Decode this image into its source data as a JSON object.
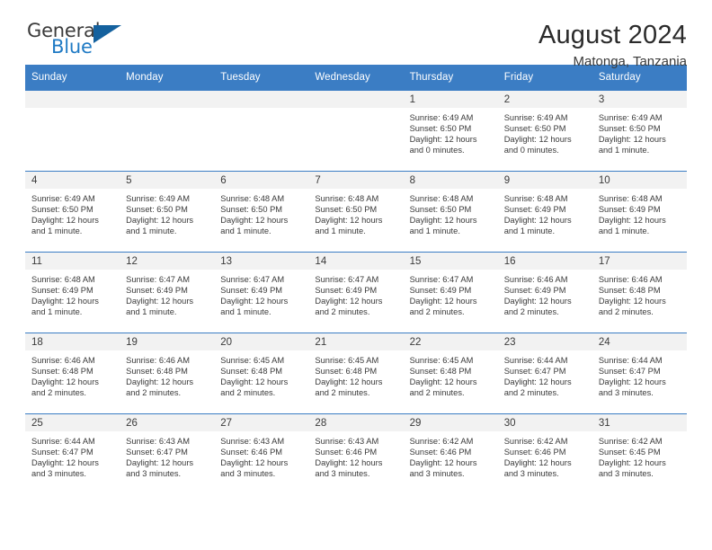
{
  "brand": {
    "name_part1": "General",
    "name_part2": "Blue",
    "triangle_icon": "triangle-icon",
    "color_dark": "#3b3b3b",
    "color_blue": "#1f7ac4",
    "triangle_color": "#14619e"
  },
  "header": {
    "title": "August 2024",
    "subtitle": "Matonga, Tanzania"
  },
  "accent_color": "#3b7dc4",
  "daynum_bg": "#f2f2f2",
  "weekdays": [
    "Sunday",
    "Monday",
    "Tuesday",
    "Wednesday",
    "Thursday",
    "Friday",
    "Saturday"
  ],
  "labels": {
    "sunrise": "Sunrise:",
    "sunset": "Sunset:",
    "daylight": "Daylight:"
  },
  "weeks": [
    [
      {
        "day": "",
        "empty": true
      },
      {
        "day": "",
        "empty": true
      },
      {
        "day": "",
        "empty": true
      },
      {
        "day": "",
        "empty": true
      },
      {
        "day": "1",
        "sunrise": "Sunrise: 6:49 AM",
        "sunset": "Sunset: 6:50 PM",
        "daylight1": "Daylight: 12 hours",
        "daylight2": "and 0 minutes."
      },
      {
        "day": "2",
        "sunrise": "Sunrise: 6:49 AM",
        "sunset": "Sunset: 6:50 PM",
        "daylight1": "Daylight: 12 hours",
        "daylight2": "and 0 minutes."
      },
      {
        "day": "3",
        "sunrise": "Sunrise: 6:49 AM",
        "sunset": "Sunset: 6:50 PM",
        "daylight1": "Daylight: 12 hours",
        "daylight2": "and 1 minute."
      }
    ],
    [
      {
        "day": "4",
        "sunrise": "Sunrise: 6:49 AM",
        "sunset": "Sunset: 6:50 PM",
        "daylight1": "Daylight: 12 hours",
        "daylight2": "and 1 minute."
      },
      {
        "day": "5",
        "sunrise": "Sunrise: 6:49 AM",
        "sunset": "Sunset: 6:50 PM",
        "daylight1": "Daylight: 12 hours",
        "daylight2": "and 1 minute."
      },
      {
        "day": "6",
        "sunrise": "Sunrise: 6:48 AM",
        "sunset": "Sunset: 6:50 PM",
        "daylight1": "Daylight: 12 hours",
        "daylight2": "and 1 minute."
      },
      {
        "day": "7",
        "sunrise": "Sunrise: 6:48 AM",
        "sunset": "Sunset: 6:50 PM",
        "daylight1": "Daylight: 12 hours",
        "daylight2": "and 1 minute."
      },
      {
        "day": "8",
        "sunrise": "Sunrise: 6:48 AM",
        "sunset": "Sunset: 6:50 PM",
        "daylight1": "Daylight: 12 hours",
        "daylight2": "and 1 minute."
      },
      {
        "day": "9",
        "sunrise": "Sunrise: 6:48 AM",
        "sunset": "Sunset: 6:49 PM",
        "daylight1": "Daylight: 12 hours",
        "daylight2": "and 1 minute."
      },
      {
        "day": "10",
        "sunrise": "Sunrise: 6:48 AM",
        "sunset": "Sunset: 6:49 PM",
        "daylight1": "Daylight: 12 hours",
        "daylight2": "and 1 minute."
      }
    ],
    [
      {
        "day": "11",
        "sunrise": "Sunrise: 6:48 AM",
        "sunset": "Sunset: 6:49 PM",
        "daylight1": "Daylight: 12 hours",
        "daylight2": "and 1 minute."
      },
      {
        "day": "12",
        "sunrise": "Sunrise: 6:47 AM",
        "sunset": "Sunset: 6:49 PM",
        "daylight1": "Daylight: 12 hours",
        "daylight2": "and 1 minute."
      },
      {
        "day": "13",
        "sunrise": "Sunrise: 6:47 AM",
        "sunset": "Sunset: 6:49 PM",
        "daylight1": "Daylight: 12 hours",
        "daylight2": "and 1 minute."
      },
      {
        "day": "14",
        "sunrise": "Sunrise: 6:47 AM",
        "sunset": "Sunset: 6:49 PM",
        "daylight1": "Daylight: 12 hours",
        "daylight2": "and 2 minutes."
      },
      {
        "day": "15",
        "sunrise": "Sunrise: 6:47 AM",
        "sunset": "Sunset: 6:49 PM",
        "daylight1": "Daylight: 12 hours",
        "daylight2": "and 2 minutes."
      },
      {
        "day": "16",
        "sunrise": "Sunrise: 6:46 AM",
        "sunset": "Sunset: 6:49 PM",
        "daylight1": "Daylight: 12 hours",
        "daylight2": "and 2 minutes."
      },
      {
        "day": "17",
        "sunrise": "Sunrise: 6:46 AM",
        "sunset": "Sunset: 6:48 PM",
        "daylight1": "Daylight: 12 hours",
        "daylight2": "and 2 minutes."
      }
    ],
    [
      {
        "day": "18",
        "sunrise": "Sunrise: 6:46 AM",
        "sunset": "Sunset: 6:48 PM",
        "daylight1": "Daylight: 12 hours",
        "daylight2": "and 2 minutes."
      },
      {
        "day": "19",
        "sunrise": "Sunrise: 6:46 AM",
        "sunset": "Sunset: 6:48 PM",
        "daylight1": "Daylight: 12 hours",
        "daylight2": "and 2 minutes."
      },
      {
        "day": "20",
        "sunrise": "Sunrise: 6:45 AM",
        "sunset": "Sunset: 6:48 PM",
        "daylight1": "Daylight: 12 hours",
        "daylight2": "and 2 minutes."
      },
      {
        "day": "21",
        "sunrise": "Sunrise: 6:45 AM",
        "sunset": "Sunset: 6:48 PM",
        "daylight1": "Daylight: 12 hours",
        "daylight2": "and 2 minutes."
      },
      {
        "day": "22",
        "sunrise": "Sunrise: 6:45 AM",
        "sunset": "Sunset: 6:48 PM",
        "daylight1": "Daylight: 12 hours",
        "daylight2": "and 2 minutes."
      },
      {
        "day": "23",
        "sunrise": "Sunrise: 6:44 AM",
        "sunset": "Sunset: 6:47 PM",
        "daylight1": "Daylight: 12 hours",
        "daylight2": "and 2 minutes."
      },
      {
        "day": "24",
        "sunrise": "Sunrise: 6:44 AM",
        "sunset": "Sunset: 6:47 PM",
        "daylight1": "Daylight: 12 hours",
        "daylight2": "and 3 minutes."
      }
    ],
    [
      {
        "day": "25",
        "sunrise": "Sunrise: 6:44 AM",
        "sunset": "Sunset: 6:47 PM",
        "daylight1": "Daylight: 12 hours",
        "daylight2": "and 3 minutes."
      },
      {
        "day": "26",
        "sunrise": "Sunrise: 6:43 AM",
        "sunset": "Sunset: 6:47 PM",
        "daylight1": "Daylight: 12 hours",
        "daylight2": "and 3 minutes."
      },
      {
        "day": "27",
        "sunrise": "Sunrise: 6:43 AM",
        "sunset": "Sunset: 6:46 PM",
        "daylight1": "Daylight: 12 hours",
        "daylight2": "and 3 minutes."
      },
      {
        "day": "28",
        "sunrise": "Sunrise: 6:43 AM",
        "sunset": "Sunset: 6:46 PM",
        "daylight1": "Daylight: 12 hours",
        "daylight2": "and 3 minutes."
      },
      {
        "day": "29",
        "sunrise": "Sunrise: 6:42 AM",
        "sunset": "Sunset: 6:46 PM",
        "daylight1": "Daylight: 12 hours",
        "daylight2": "and 3 minutes."
      },
      {
        "day": "30",
        "sunrise": "Sunrise: 6:42 AM",
        "sunset": "Sunset: 6:46 PM",
        "daylight1": "Daylight: 12 hours",
        "daylight2": "and 3 minutes."
      },
      {
        "day": "31",
        "sunrise": "Sunrise: 6:42 AM",
        "sunset": "Sunset: 6:45 PM",
        "daylight1": "Daylight: 12 hours",
        "daylight2": "and 3 minutes."
      }
    ]
  ]
}
